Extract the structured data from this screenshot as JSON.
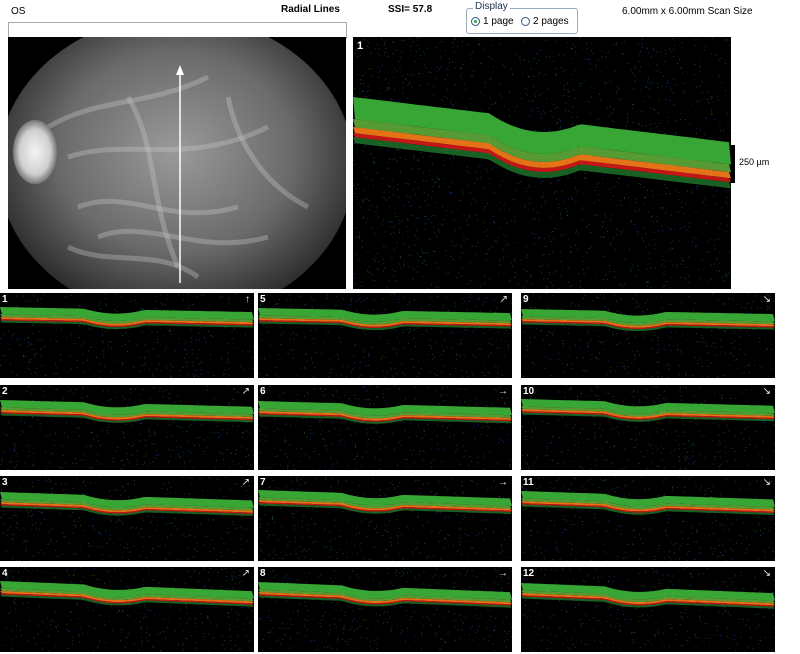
{
  "header": {
    "eye": "OS",
    "scan_type": "Radial Lines",
    "ssi": "SSI= 57.8",
    "display_legend": "Display",
    "display_options": [
      "1 page",
      "2 pages"
    ],
    "display_selected": "1 page",
    "scan_size": "6.00mm x 6.00mm Scan Size"
  },
  "main_scan": {
    "number": "1",
    "scale_label": "250 µm"
  },
  "tiles": [
    {
      "number": "1",
      "arrow": "↑"
    },
    {
      "number": "2",
      "arrow": "↗"
    },
    {
      "number": "3",
      "arrow": "↗"
    },
    {
      "number": "4",
      "arrow": "↗"
    },
    {
      "number": "5",
      "arrow": "↗"
    },
    {
      "number": "6",
      "arrow": "→"
    },
    {
      "number": "7",
      "arrow": "→"
    },
    {
      "number": "8",
      "arrow": "→"
    },
    {
      "number": "9",
      "arrow": "↘"
    },
    {
      "number": "10",
      "arrow": "↘"
    },
    {
      "number": "11",
      "arrow": "↘"
    },
    {
      "number": "12",
      "arrow": "↘"
    }
  ],
  "colors": {
    "retina_green": "#3db83a",
    "rpe_orange": "#f07818",
    "rpe_red": "#d81818",
    "noise_blue": "#2a5bd0"
  }
}
